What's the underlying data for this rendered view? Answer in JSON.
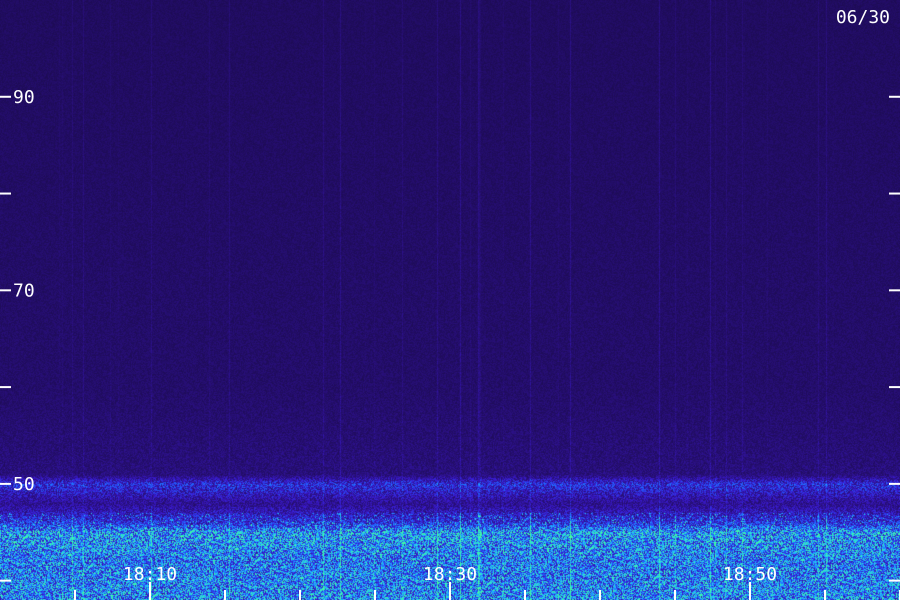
{
  "chart_data": {
    "type": "heatmap",
    "title": "",
    "date_label": "06/30",
    "xlabel": "",
    "ylabel": "",
    "y_ticks": [
      {
        "value": 90,
        "label": "90"
      },
      {
        "value": 80,
        "label": ""
      },
      {
        "value": 70,
        "label": "70"
      },
      {
        "value": 60,
        "label": ""
      },
      {
        "value": 50,
        "label": "50"
      },
      {
        "value": 40,
        "label": ""
      }
    ],
    "x_ticks": [
      {
        "value": 0,
        "label": ""
      },
      {
        "value": 1,
        "label": "18:10"
      },
      {
        "value": 2,
        "label": ""
      },
      {
        "value": 3,
        "label": ""
      },
      {
        "value": 4,
        "label": ""
      },
      {
        "value": 5,
        "label": "18:30"
      },
      {
        "value": 6,
        "label": ""
      },
      {
        "value": 7,
        "label": ""
      },
      {
        "value": 8,
        "label": ""
      },
      {
        "value": 9,
        "label": "18:50"
      },
      {
        "value": 10,
        "label": ""
      },
      {
        "value": 11,
        "label": ""
      }
    ],
    "ylim": [
      38,
      100
    ],
    "xlim": [
      -1,
      11
    ],
    "colormap": [
      "#1a0a4a",
      "#2a1080",
      "#3a1ad0",
      "#2060ff",
      "#20c0ff",
      "#40ffa0"
    ],
    "intensity_profile": [
      {
        "y": 100,
        "level": 0.1
      },
      {
        "y": 60,
        "level": 0.15
      },
      {
        "y": 51,
        "level": 0.22
      },
      {
        "y": 50,
        "level": 0.55
      },
      {
        "y": 48,
        "level": 0.3
      },
      {
        "y": 46,
        "level": 0.55
      },
      {
        "y": 45,
        "level": 0.85
      },
      {
        "y": 42,
        "level": 0.75
      },
      {
        "y": 38,
        "level": 0.8
      }
    ]
  }
}
